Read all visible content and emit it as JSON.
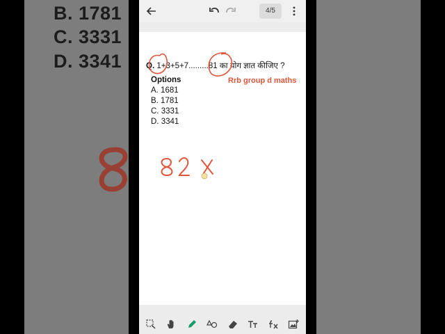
{
  "background": {
    "options": [
      "B. 1781",
      "C. 3331",
      "D. 3341"
    ]
  },
  "toolbar": {
    "page_indicator": "4/5"
  },
  "question": {
    "label": "Q.",
    "text": "1+3+5+7.........81 का योग ज्ञात कीजिए ?",
    "source": "Rrb group d maths"
  },
  "options": {
    "title": "Options",
    "items": [
      "A. 1681",
      "B. 1781",
      "C. 3331",
      "D. 3341"
    ]
  },
  "handwriting": {
    "text": "82x"
  },
  "colors": {
    "ink_red": "#e0553b",
    "pen_green": "#1a9b6c"
  }
}
